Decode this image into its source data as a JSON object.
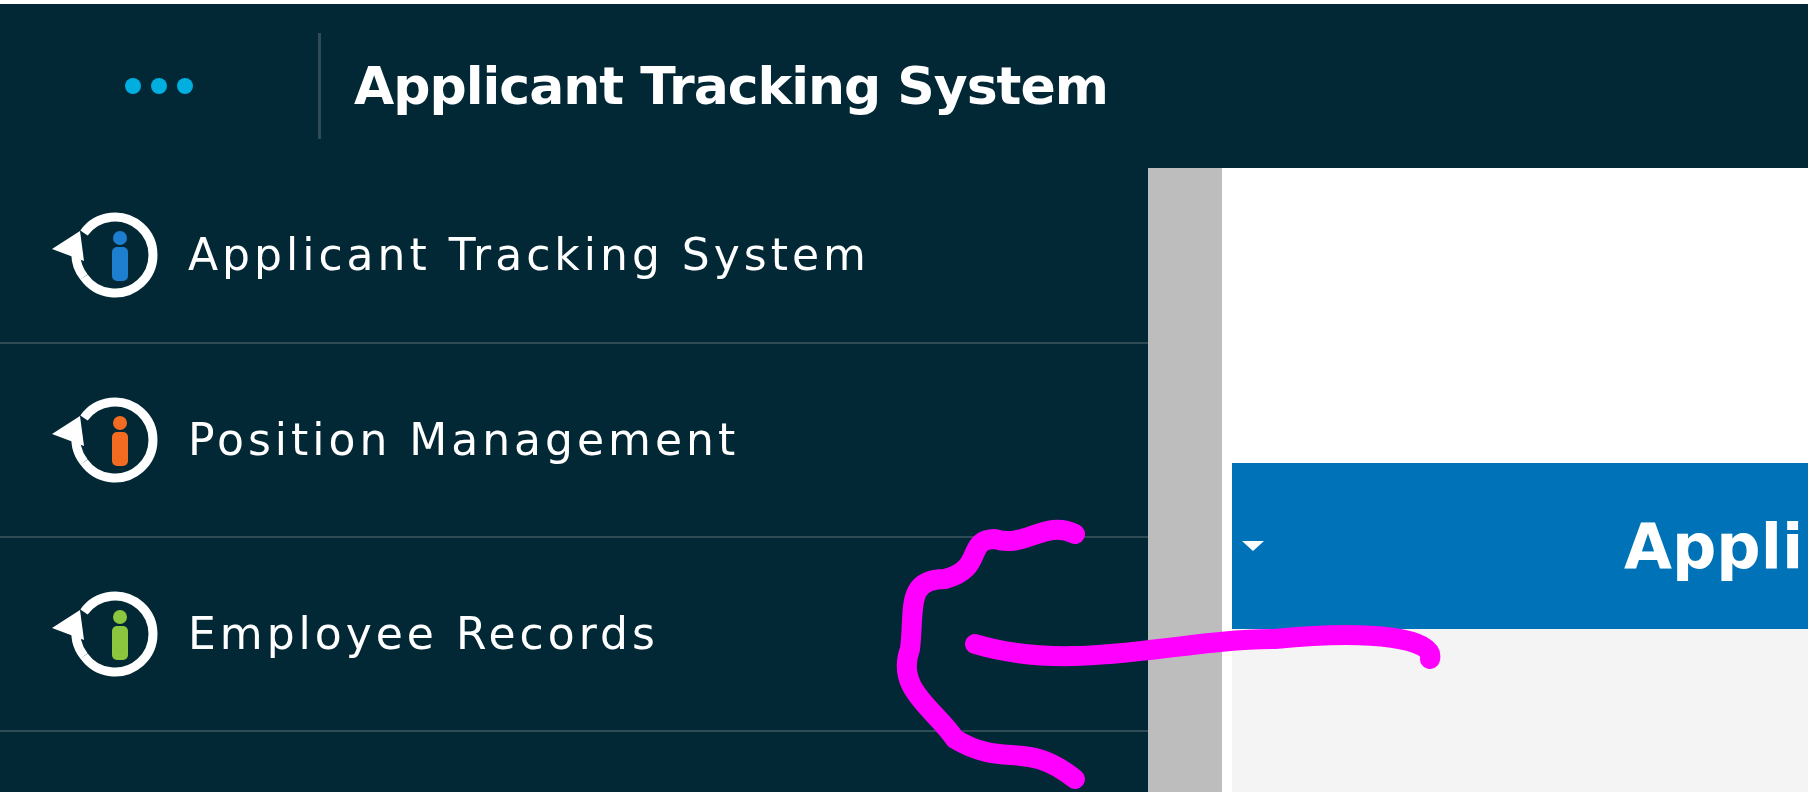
{
  "header": {
    "title": "Applicant Tracking System"
  },
  "sidebar": {
    "items": [
      {
        "label": "Applicant Tracking System",
        "color": "#1e7fd0"
      },
      {
        "label": "Position Management",
        "color": "#f26b21"
      },
      {
        "label": "Employee Records",
        "color": "#8cc63f"
      }
    ]
  },
  "content": {
    "banner": {
      "text": "Appli"
    }
  }
}
